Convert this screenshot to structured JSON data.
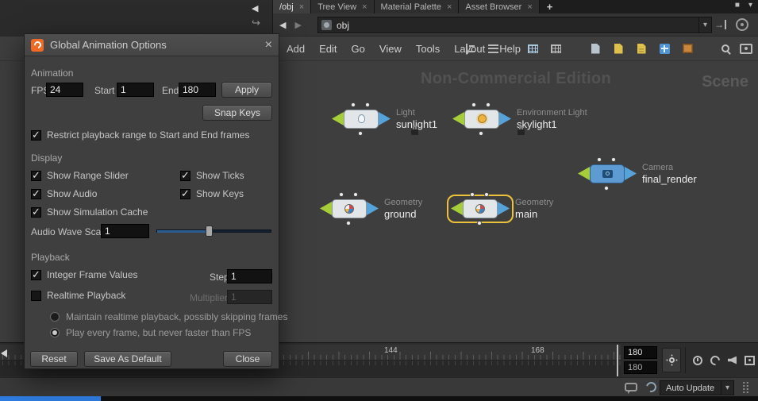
{
  "colors": {
    "houdini_orange": "#F06A23",
    "node_wing_green": "#A6CE39",
    "node_wing_blue": "#56A3D9",
    "selection_yellow": "#ECC23A",
    "slider_blue": "#2E5D92",
    "statusbar_accent_blue": "#2E7CE0"
  },
  "icons": {
    "close": "×",
    "dropdown": "▾",
    "add_tab": "+",
    "back": "◀",
    "forward": "▶",
    "check": "✓",
    "pin_arrow": "→",
    "maximize": "■",
    "collapse": "◀",
    "link_arrow": "↪"
  },
  "tabs": {
    "items": [
      {
        "label": "/obj"
      },
      {
        "label": "Tree View"
      },
      {
        "label": "Material Palette"
      },
      {
        "label": "Asset Browser"
      }
    ]
  },
  "pathbar": {
    "value": "obj"
  },
  "menubar": {
    "items": [
      "Add",
      "Edit",
      "Go",
      "View",
      "Tools",
      "Layout",
      "Help"
    ]
  },
  "network": {
    "watermark": "Non-Commercial Edition",
    "context": "Scene",
    "nodes": [
      {
        "type": "Light",
        "name": "sunlight1"
      },
      {
        "type": "Environment Light",
        "name": "skylight1"
      },
      {
        "type": "Camera",
        "name": "final_render"
      },
      {
        "type": "Geometry",
        "name": "ground"
      },
      {
        "type": "Geometry",
        "name": "main",
        "selected": true
      }
    ]
  },
  "playbar": {
    "tick_labels": [
      "144",
      "168"
    ],
    "current_frame": "180",
    "end_frame": "180"
  },
  "statusbar": {
    "auto_update": "Auto Update"
  },
  "dialog": {
    "title": "Global Animation Options",
    "animation": {
      "section": "Animation",
      "fps_label": "FPS",
      "fps": "24",
      "start_label": "Start",
      "start": "1",
      "end_label": "End",
      "end": "180",
      "apply": "Apply",
      "snap_keys": "Snap Keys",
      "restrict": "Restrict playback range to Start and End frames"
    },
    "display": {
      "section": "Display",
      "show_range_slider": "Show Range Slider",
      "show_ticks": "Show Ticks",
      "show_audio": "Show Audio",
      "show_keys": "Show Keys",
      "show_simulation_cache": "Show Simulation Cache",
      "audio_wave_scale_label": "Audio Wave Scale",
      "audio_wave_scale": "1"
    },
    "playback": {
      "section": "Playback",
      "integer_frame_values": "Integer Frame Values",
      "step_label": "Step",
      "step": "1",
      "realtime_playback": "Realtime Playback",
      "multiplier_label": "Multiplier",
      "multiplier": "1",
      "radio_realtime": "Maintain realtime playback, possibly skipping frames",
      "radio_every_frame": "Play every frame, but never faster than FPS"
    },
    "buttons": {
      "reset": "Reset",
      "save_as_default": "Save As Default",
      "close": "Close"
    }
  }
}
